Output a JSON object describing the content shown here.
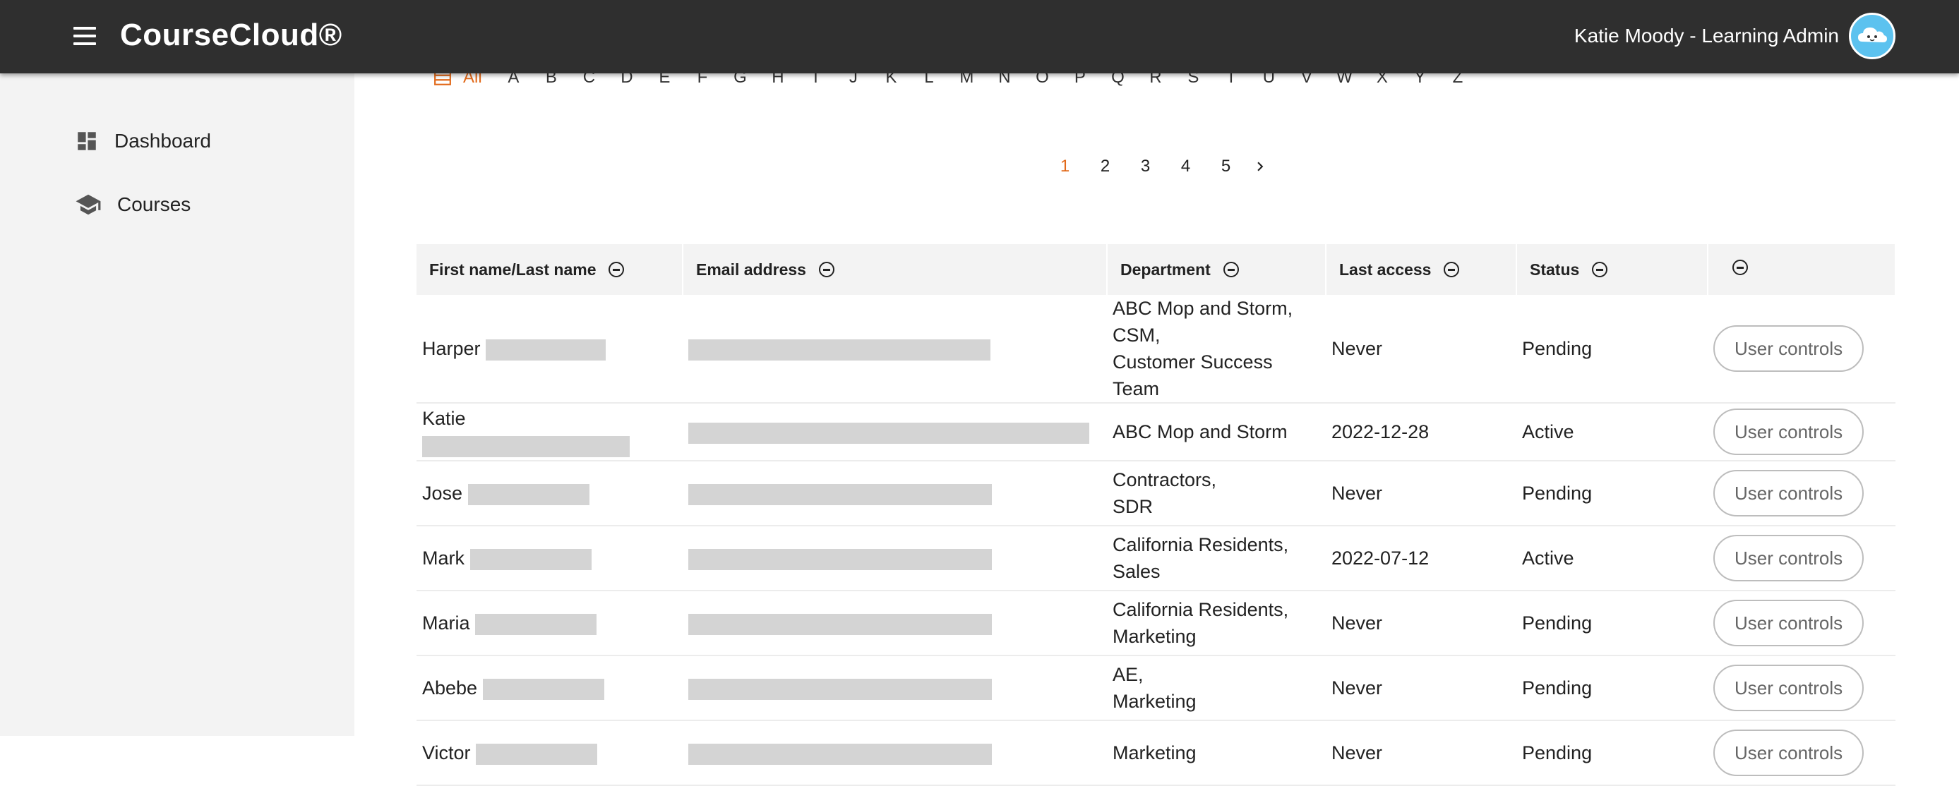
{
  "header": {
    "brand": "CourseCloud®",
    "user_label": "Katie Moody - Learning Admin"
  },
  "sidebar": {
    "items": [
      {
        "label": "Dashboard",
        "icon": "dashboard-icon"
      },
      {
        "label": "Courses",
        "icon": "school-icon"
      }
    ]
  },
  "filter": {
    "all_label": "All",
    "letters": [
      "A",
      "B",
      "C",
      "D",
      "E",
      "F",
      "G",
      "H",
      "I",
      "J",
      "K",
      "L",
      "M",
      "N",
      "O",
      "P",
      "Q",
      "R",
      "S",
      "T",
      "U",
      "V",
      "W",
      "X",
      "Y",
      "Z"
    ]
  },
  "pagination": {
    "pages": [
      "1",
      "2",
      "3",
      "4",
      "5"
    ],
    "current": "1"
  },
  "table": {
    "headers": {
      "first": "First name",
      "sep": " / ",
      "last": "Last name",
      "email": "Email address",
      "department": "Department",
      "last_access": "Last access",
      "status": "Status"
    },
    "rows": [
      {
        "first": "Harper",
        "dept1": "ABC Mop and Storm,",
        "dept2": "CSM,",
        "dept3": "Customer Success Team",
        "last_access": "Never",
        "status": "Pending",
        "action": "User controls"
      },
      {
        "first": "Katie",
        "dept1": "ABC Mop and Storm",
        "dept2": "",
        "dept3": "",
        "last_access": "2022-12-28",
        "status": "Active",
        "action": "User controls"
      },
      {
        "first": "Jose",
        "dept1": "Contractors,",
        "dept2": "SDR",
        "dept3": "",
        "last_access": "Never",
        "status": "Pending",
        "action": "User controls"
      },
      {
        "first": "Mark",
        "dept1": "California Residents,",
        "dept2": "Sales",
        "dept3": "",
        "last_access": "2022-07-12",
        "status": "Active",
        "action": "User controls"
      },
      {
        "first": "Maria",
        "dept1": "California Residents,",
        "dept2": "Marketing",
        "dept3": "",
        "last_access": "Never",
        "status": "Pending",
        "action": "User controls"
      },
      {
        "first": "Abebe",
        "dept1": "AE,",
        "dept2": "Marketing",
        "dept3": "",
        "last_access": "Never",
        "status": "Pending",
        "action": "User controls"
      },
      {
        "first": "Victor",
        "dept1": "Marketing",
        "dept2": "",
        "dept3": "",
        "last_access": "Never",
        "status": "Pending",
        "action": "User controls"
      }
    ]
  },
  "colors": {
    "accent": "#e26a1b",
    "topbar": "#2f2f2f",
    "sidebar": "#f3f3f3",
    "avatar": "#5cc2ef",
    "redaction": "#d4d4d4"
  }
}
